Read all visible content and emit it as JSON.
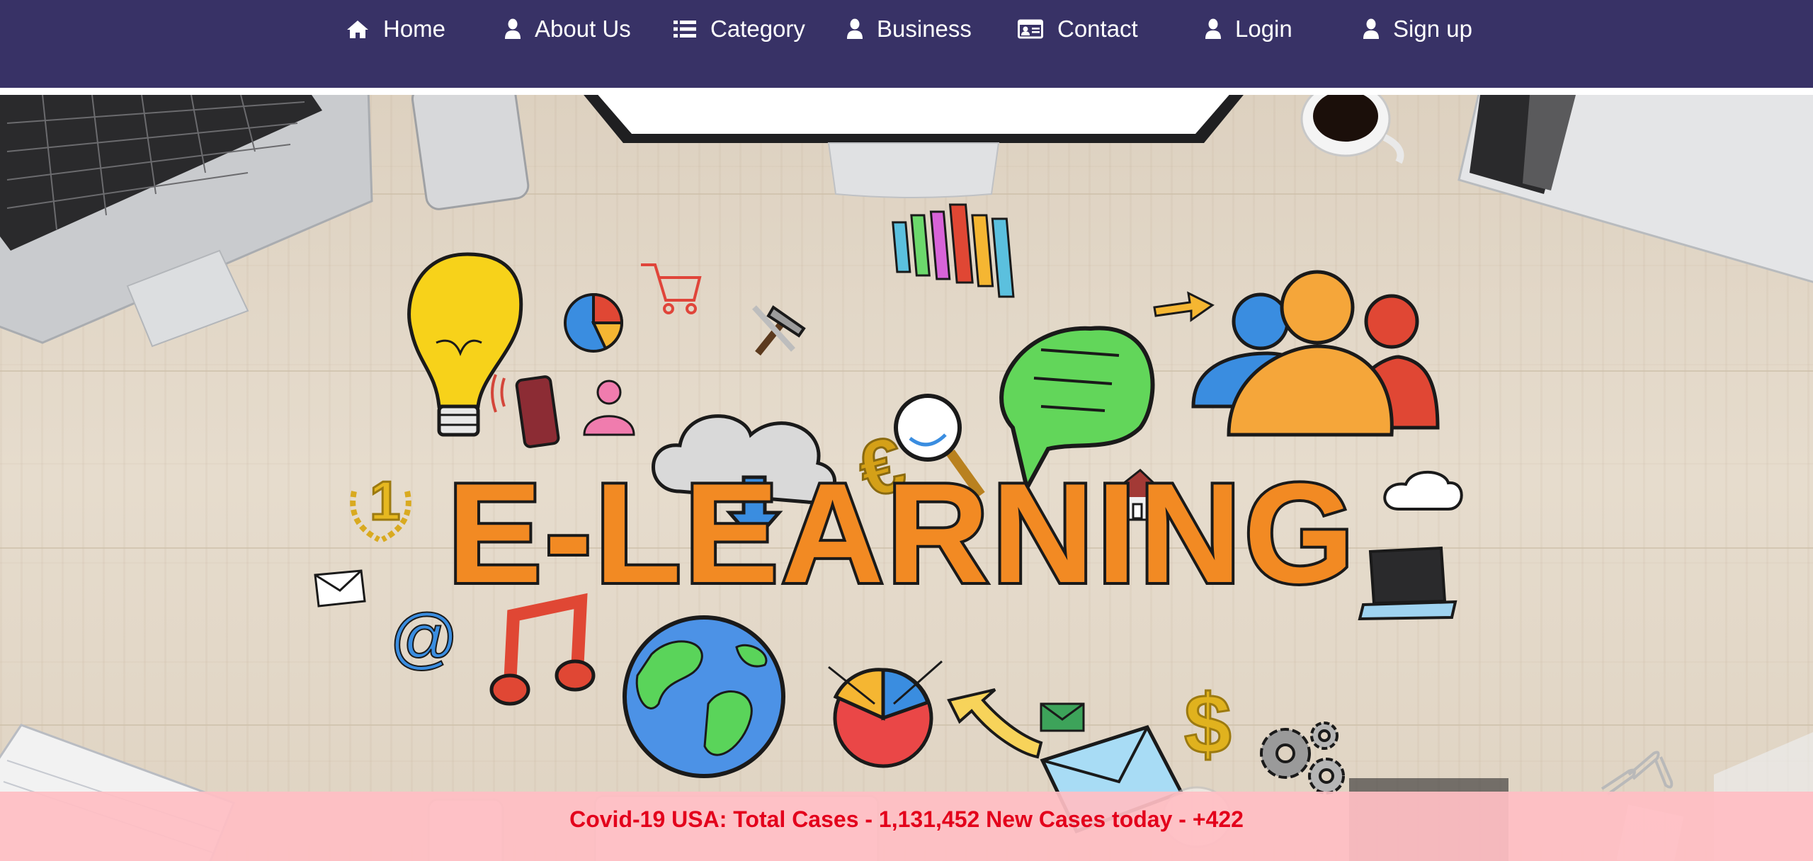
{
  "nav": {
    "items": [
      {
        "label": "Home",
        "icon": "home-icon"
      },
      {
        "label": "About Us",
        "icon": "user-icon"
      },
      {
        "label": "Category",
        "icon": "list-icon"
      },
      {
        "label": "Business",
        "icon": "user-icon"
      },
      {
        "label": "Contact",
        "icon": "id-card-icon"
      },
      {
        "label": "Login",
        "icon": "user-icon"
      },
      {
        "label": "Sign up",
        "icon": "user-icon"
      }
    ]
  },
  "hero": {
    "title": "E-LEARNING"
  },
  "covid": {
    "text": "Covid-19 USA: Total Cases - 1,131,452 New Cases today - +422"
  },
  "colors": {
    "nav_bg": "#383266",
    "nav_text": "#ffffff",
    "title_orange": "#f28a23",
    "covid_bg": "#ffbec4",
    "covid_text": "#e3001b"
  }
}
